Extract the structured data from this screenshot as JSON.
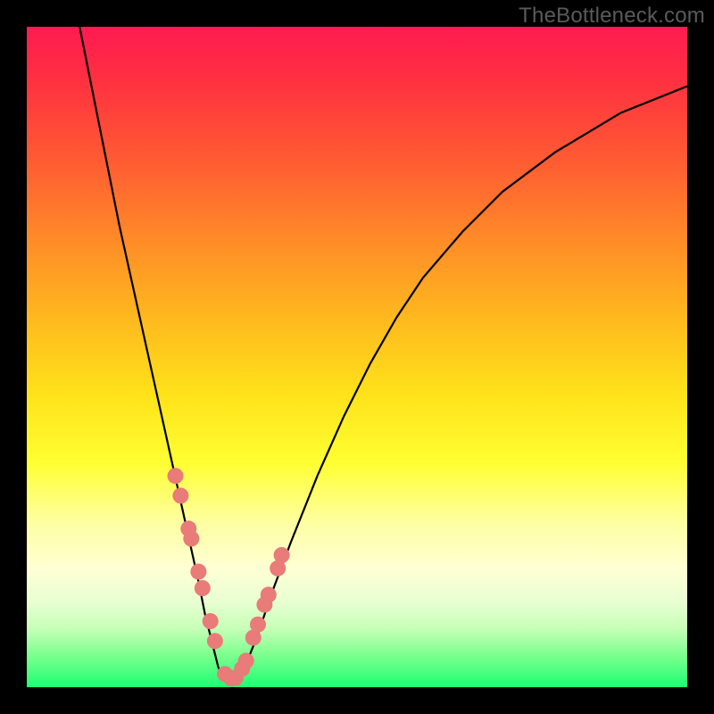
{
  "watermark": "TheBottleneck.com",
  "colors": {
    "dot": "#e97b78",
    "curve": "#000000",
    "frame": "#000000"
  },
  "chart_data": {
    "type": "line",
    "title": "",
    "xlabel": "",
    "ylabel": "",
    "xlim": [
      0,
      100
    ],
    "ylim": [
      0,
      100
    ],
    "grid": false,
    "legend": false,
    "series": [
      {
        "name": "bottleneck-curve",
        "x": [
          8,
          10,
          12,
          14,
          16,
          18,
          20,
          22,
          24,
          26,
          27,
          28,
          29,
          30,
          31,
          32,
          33,
          35,
          37,
          40,
          44,
          48,
          52,
          56,
          60,
          66,
          72,
          80,
          90,
          100
        ],
        "y": [
          100,
          90,
          80,
          70,
          61,
          52,
          43,
          34,
          25,
          16,
          11,
          7,
          3,
          1,
          0.5,
          1,
          3,
          8,
          14,
          22,
          32,
          41,
          49,
          56,
          62,
          69,
          75,
          81,
          87,
          91
        ]
      }
    ],
    "highlighted_points": {
      "name": "dots",
      "x": [
        22.5,
        23.3,
        24.5,
        24.9,
        26.0,
        26.6,
        27.8,
        28.5,
        30.0,
        31.0,
        31.6,
        32.6,
        33.2,
        34.3,
        35.0,
        36.0,
        36.6,
        38.0,
        38.6
      ],
      "y": [
        32,
        29,
        24,
        22.5,
        17.5,
        15,
        10,
        7,
        2,
        1.3,
        1.4,
        2.8,
        4,
        7.5,
        9.5,
        12.5,
        14,
        18,
        20
      ]
    }
  }
}
